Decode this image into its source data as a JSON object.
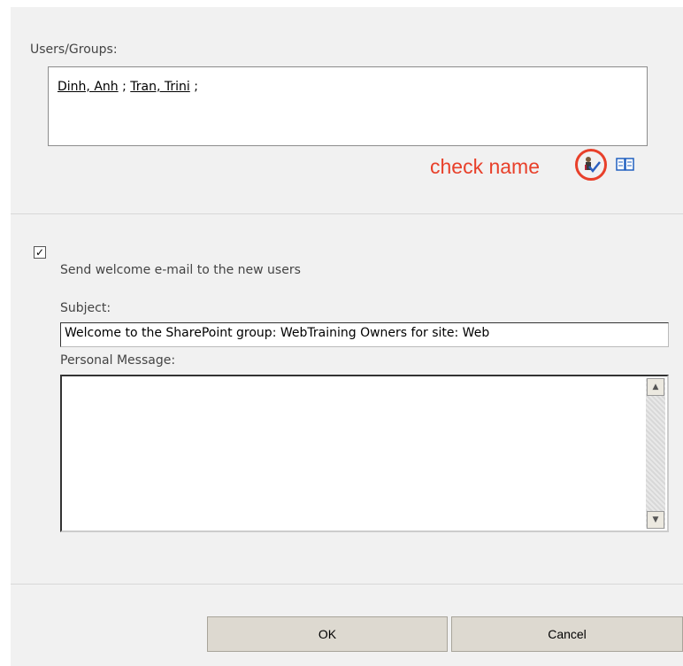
{
  "users_groups": {
    "label": "Users/Groups:",
    "people": [
      "Dinh, Anh",
      "Tran, Trini"
    ],
    "separator": ";"
  },
  "annotation": {
    "text": "check name",
    "color": "#e8402a"
  },
  "icons": {
    "check_names": "check-names-icon",
    "browse": "address-book-icon"
  },
  "welcome": {
    "checked": true,
    "checkbox_glyph": "✓",
    "label": "Send welcome e-mail to the new users"
  },
  "subject": {
    "label": "Subject:",
    "value": "Welcome to the SharePoint group: WebTraining Owners for site: Web"
  },
  "message": {
    "label": "Personal Message:",
    "value": ""
  },
  "buttons": {
    "ok": "OK",
    "cancel": "Cancel"
  }
}
